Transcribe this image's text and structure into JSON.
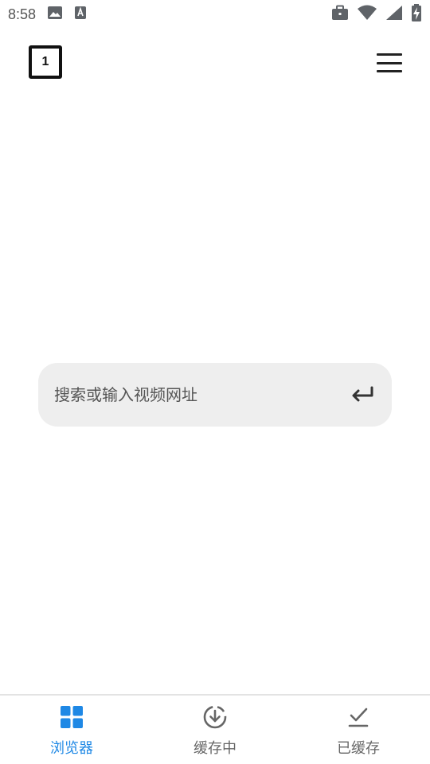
{
  "status_bar": {
    "time": "8:58",
    "icons": [
      "image-icon",
      "a-text-icon",
      "briefcase-icon",
      "wifi-icon",
      "signal-icon",
      "battery-charging-icon"
    ]
  },
  "header": {
    "tab_count": "1",
    "menu_icon": "hamburger-menu-icon"
  },
  "search": {
    "placeholder": "搜索或输入视频网址",
    "value": "",
    "enter_icon": "enter-return-icon"
  },
  "bottom_nav": {
    "items": [
      {
        "label": "浏览器",
        "icon": "grid-icon",
        "active": true
      },
      {
        "label": "缓存中",
        "icon": "download-progress-icon",
        "active": false
      },
      {
        "label": "已缓存",
        "icon": "check-tray-icon",
        "active": false
      }
    ]
  },
  "colors": {
    "accent": "#1e88e5",
    "search_bg": "#eeeeee",
    "inactive": "#666666"
  }
}
